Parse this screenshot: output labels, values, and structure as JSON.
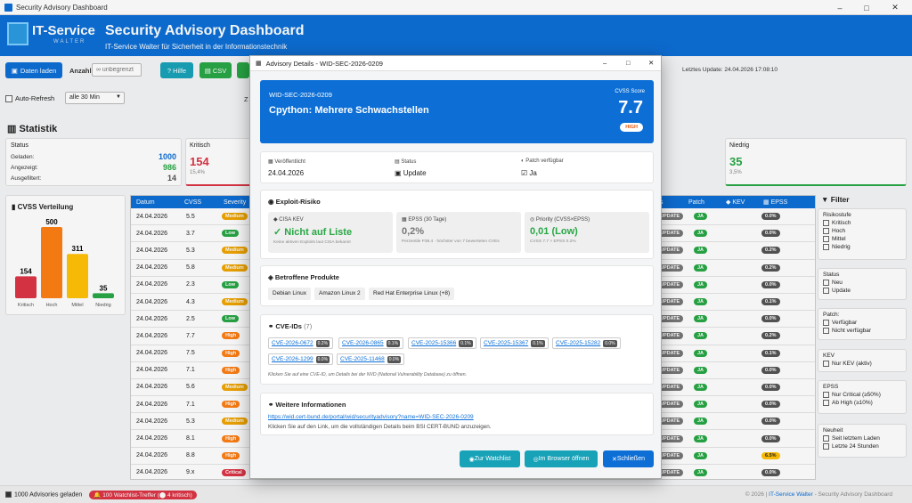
{
  "window": {
    "title": "Security Advisory Dashboard",
    "minimize": "–",
    "maximize": "□",
    "close": "✕"
  },
  "banner": {
    "logo_text": "IT-Service",
    "logo_sub": "WALTER",
    "title": "Security Advisory Dashboard",
    "subtitle": "IT-Service Walter für Sicherheit in der Informationstechnik"
  },
  "toolbar": {
    "load": "Daten laden",
    "count_label": "Anzahl:",
    "count_placeholder": "∞ unbegrenzt",
    "help": "Hilfe",
    "csv": "CSV",
    "last_update": "Letztes Update: 24.04.2026 17:08:10",
    "auto_refresh": "Auto-Refresh",
    "interval": "alle 30 Min",
    "cut_label": "Z"
  },
  "stats": {
    "title": "Statistik",
    "status_card": {
      "title": "Status",
      "loaded_label": "Geladen:",
      "loaded": "1000",
      "shown_label": "Angezeigt:",
      "shown": "986",
      "filtered_label": "Ausgefiltert:",
      "filtered": "14"
    },
    "critical": {
      "title": "Kritisch",
      "value": "154",
      "pct": "15,4%"
    },
    "low": {
      "title": "Niedrig",
      "value": "35",
      "pct": "3,5%"
    }
  },
  "cvss_chart_title": "CVSS Verteilung",
  "chart_data": {
    "type": "bar",
    "title": "CVSS Verteilung",
    "categories": [
      "Kritisch",
      "Hoch",
      "Mittel",
      "Niedrig"
    ],
    "values": [
      154,
      500,
      311,
      35
    ],
    "colors": [
      "#dc3545",
      "#fd7e14",
      "#ffc107",
      "#28a745"
    ]
  },
  "table": {
    "headers": [
      "Datum",
      "CVSS",
      "Severity",
      "us",
      "Patch",
      "KEV",
      "EPSS"
    ],
    "rows": [
      {
        "date": "24.04.2026",
        "cvss": "5.5",
        "sev": "Medium",
        "epss": "0.0%"
      },
      {
        "date": "24.04.2026",
        "cvss": "3.7",
        "sev": "Low",
        "epss": "0.0%"
      },
      {
        "date": "24.04.2026",
        "cvss": "5.3",
        "sev": "Medium",
        "epss": "0.2%"
      },
      {
        "date": "24.04.2026",
        "cvss": "5.8",
        "sev": "Medium",
        "epss": "0.2%"
      },
      {
        "date": "24.04.2026",
        "cvss": "2.3",
        "sev": "Low",
        "epss": "0.0%"
      },
      {
        "date": "24.04.2026",
        "cvss": "4.3",
        "sev": "Medium",
        "epss": "0.1%"
      },
      {
        "date": "24.04.2026",
        "cvss": "2.5",
        "sev": "Low",
        "epss": "0.0%"
      },
      {
        "date": "24.04.2026",
        "cvss": "7.7",
        "sev": "High",
        "epss": "0.2%"
      },
      {
        "date": "24.04.2026",
        "cvss": "7.5",
        "sev": "High",
        "epss": "0.1%"
      },
      {
        "date": "24.04.2026",
        "cvss": "7.1",
        "sev": "High",
        "epss": "0.0%"
      },
      {
        "date": "24.04.2026",
        "cvss": "5.6",
        "sev": "Medium",
        "epss": "0.0%"
      },
      {
        "date": "24.04.2026",
        "cvss": "7.1",
        "sev": "High",
        "epss": "0.0%"
      },
      {
        "date": "24.04.2026",
        "cvss": "5.3",
        "sev": "Medium",
        "epss": "0.0%"
      },
      {
        "date": "24.04.2026",
        "cvss": "8.1",
        "sev": "High",
        "epss": "0.0%"
      },
      {
        "date": "24.04.2026",
        "cvss": "8.8",
        "sev": "High",
        "epss": "6.5%"
      },
      {
        "date": "24.04.2026",
        "cvss": "9.x",
        "sev": "Critical",
        "epss": "0.0%"
      }
    ],
    "status_badge": "UPDATE",
    "patch_badge": "JA"
  },
  "filter": {
    "title": "Filter",
    "risk_title": "Risikostufe",
    "risk": [
      "Kritisch",
      "Hoch",
      "Mittel",
      "Niedrig"
    ],
    "status_title": "Status",
    "status": [
      "Neu",
      "Update"
    ],
    "patch_title": "Patch:",
    "patch": [
      "Verfügbar",
      "Nicht verfügbar"
    ],
    "kev_title": "KEV",
    "kev": [
      "Nur KEV (aktiv)"
    ],
    "epss_title": "EPSS",
    "epss": [
      "Nur Critical (≥50%)",
      "Ab High (≥10%)"
    ],
    "new_title": "Neuheit",
    "new": [
      "Seit letztem Laden",
      "Letzte 24 Stunden"
    ]
  },
  "statusbar": {
    "loaded": "1000 Advisories geladen",
    "watch": "100 Watchlist-Treffer (",
    "watch_count": "4",
    "watch_suffix": "kritisch)",
    "footer": "© 2026 | ",
    "footer_link": "IT-Service Walter",
    "footer_end": " - Security Advisory Dashboard"
  },
  "modal": {
    "title": "Advisory Details - WID-SEC-2026-0209",
    "id": "WID-SEC-2026-0209",
    "name": "Cpython: Mehrere Schwachstellen",
    "score_label": "CVSS Score",
    "score": "7.7",
    "severity": "HIGH",
    "published_label": "Veröffentlicht",
    "published": "24.04.2026",
    "status_label": "Status",
    "status": "Update",
    "patch_label": "Patch verfügbar",
    "patch": "Ja",
    "exploit_title": "Exploit-Risiko",
    "kev_label": "CISA KEV",
    "kev_value": "✓ Nicht auf Liste",
    "kev_sub": "Keine aktiven Exploits laut CISA bekannt",
    "epss_label": "EPSS (30 Tage)",
    "epss_value": "0,2%",
    "epss_sub": "Perzentile P38.4 · höchster von 7 bewerteten CVEs",
    "prio_label": "Priority (CVSS×EPSS)",
    "prio_value": "0,01 (Low)",
    "prio_sub": "CVSS 7.7 × EPSS 0.2%",
    "products_title": "Betroffene Produkte",
    "products": [
      "Debian Linux",
      "Amazon Linux 2",
      "Red Hat Enterprise Linux (+8)"
    ],
    "cve_title": "CVE-IDs",
    "cve_count": "(7)",
    "cves": [
      {
        "id": "CVE-2026-0672",
        "p": "0.2%"
      },
      {
        "id": "CVE-2026-0865",
        "p": "0.1%"
      },
      {
        "id": "CVE-2025-15366",
        "p": "0.1%"
      },
      {
        "id": "CVE-2025-15367",
        "p": "0.1%"
      },
      {
        "id": "CVE-2025-15282",
        "p": "0.0%"
      },
      {
        "id": "CVE-2026-1299",
        "p": "0.0%"
      },
      {
        "id": "CVE-2025-11468",
        "p": "0.0%"
      }
    ],
    "cve_hint": "Klicken Sie auf eine CVE-ID, um Details bei der NVD (National Vulnerability Database) zu öffnen.",
    "info_title": "Weitere Informationen",
    "info_link": "https://wid.cert-bund.de/portal/wid/securityadvisory?name=WID-SEC-2026-0209",
    "info_hint": "Klicken Sie auf den Link, um die vollständigen Details beim BSI CERT-BUND anzuzeigen.",
    "btn_watch": "Zur Watchlist",
    "btn_browser": "Im Browser öffnen",
    "btn_close": "Schließen"
  }
}
